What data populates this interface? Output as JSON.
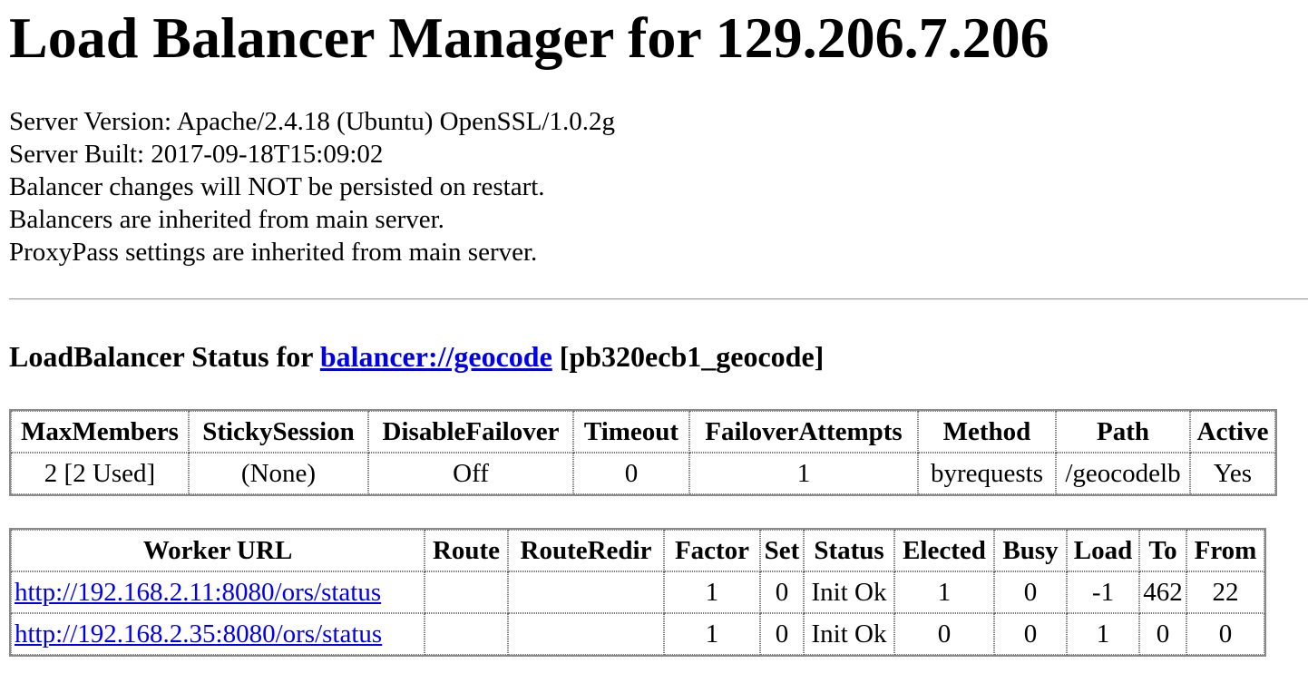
{
  "page": {
    "title": "Load Balancer Manager for 129.206.7.206"
  },
  "server_info": [
    "Server Version: Apache/2.4.18 (Ubuntu) OpenSSL/1.0.2g",
    "Server Built: 2017-09-18T15:09:02",
    "Balancer changes will NOT be persisted on restart.",
    "Balancers are inherited from main server.",
    "ProxyPass settings are inherited from main server."
  ],
  "balancer": {
    "heading_prefix": "LoadBalancer Status for ",
    "link_text": "balancer://geocode",
    "heading_suffix": " [pb320ecb1_geocode]",
    "link_color": "#0000ee"
  },
  "balancer_table": {
    "headers": [
      "MaxMembers",
      "StickySession",
      "DisableFailover",
      "Timeout",
      "FailoverAttempts",
      "Method",
      "Path",
      "Active"
    ],
    "row": [
      "2 [2 Used]",
      "(None)",
      "Off",
      "0",
      "1",
      "byrequests",
      "/geocodelb",
      "Yes"
    ]
  },
  "worker_table": {
    "headers": [
      "Worker URL",
      "Route",
      "RouteRedir",
      "Factor",
      "Set",
      "Status",
      "Elected",
      "Busy",
      "Load",
      "To",
      "From"
    ],
    "rows": [
      {
        "url": "http://192.168.2.11:8080/ors/status",
        "route": "",
        "route_redir": "",
        "factor": "1",
        "set": "0",
        "status": "Init Ok",
        "elected": "1",
        "busy": "0",
        "load": "-1",
        "to": "462",
        "from": "22"
      },
      {
        "url": "http://192.168.2.35:8080/ors/status",
        "route": "",
        "route_redir": "",
        "factor": "1",
        "set": "0",
        "status": "Init Ok",
        "elected": "0",
        "busy": "0",
        "load": "1",
        "to": "0",
        "from": "0"
      }
    ]
  }
}
